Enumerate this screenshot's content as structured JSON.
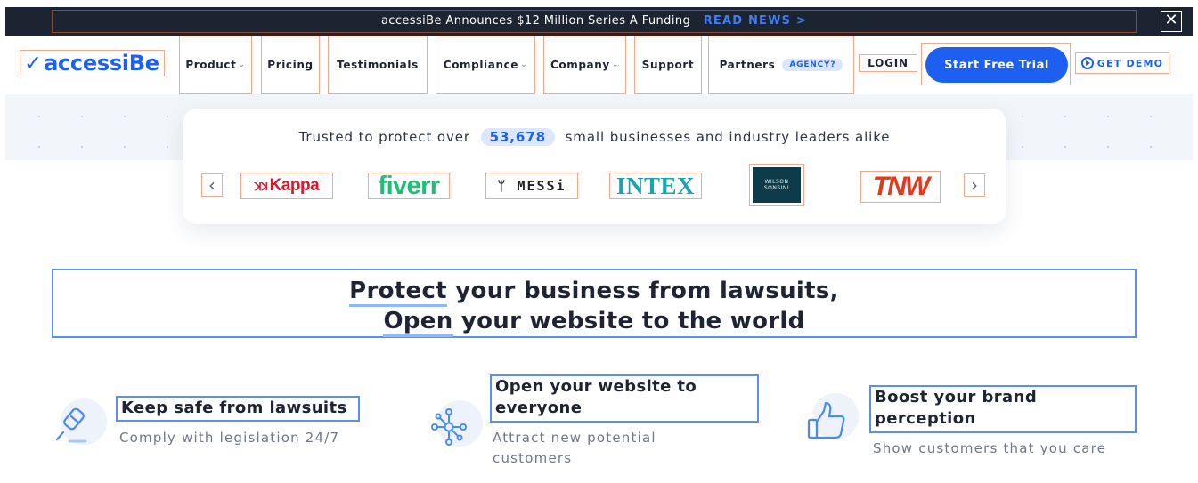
{
  "announcement": {
    "message": "accessiBe Announces $12 Million Series A Funding",
    "link": "READ NEWS >",
    "close": "✕"
  },
  "brand": {
    "logo_text": "accessiBe"
  },
  "nav": {
    "items": [
      {
        "label": "Product",
        "chevron": "⌄"
      },
      {
        "label": "Pricing"
      },
      {
        "label": "Testimonials"
      },
      {
        "label": "Compliance",
        "chevron": "⌄"
      },
      {
        "label": "Company",
        "chevron": "⌄"
      },
      {
        "label": "Support"
      },
      {
        "label": "Partners",
        "badge": "AGENCY?"
      }
    ],
    "login": "LOGIN",
    "cta": "Start Free Trial",
    "demo": "GET DEMO"
  },
  "trust": {
    "prefix": "Trusted to protect over",
    "count": "53,678",
    "suffix": "small businesses and industry leaders alike",
    "prev": "‹",
    "next": "›",
    "logos": [
      "Kappa",
      "fiverr",
      "MESSi",
      "INTEX",
      "WILSON SONSINI",
      "TNW"
    ]
  },
  "headline": {
    "line1_emph": "Protect",
    "line1_rest": " your business from lawsuits,",
    "line2_emph": "Open",
    "line2_rest": " your website to the world"
  },
  "features": [
    {
      "icon": "gavel-icon",
      "title": "Keep safe from lawsuits",
      "subtitle": "Comply with legislation 24/7"
    },
    {
      "icon": "network-icon",
      "title": "Open your website to everyone",
      "subtitle": "Attract new potential customers"
    },
    {
      "icon": "thumbs-up-icon",
      "title": "Boost your brand perception",
      "subtitle": "Show customers that you care"
    }
  ],
  "colors": {
    "brand_blue": "#1d5ff0",
    "topbar": "#1b2430"
  }
}
